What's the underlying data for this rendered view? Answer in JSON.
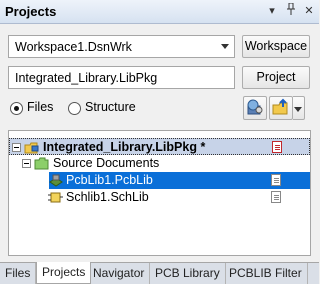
{
  "panel": {
    "title": "Projects",
    "title_buttons": [
      "▾",
      "📌",
      "✕"
    ]
  },
  "workspace": {
    "value": "Workspace1.DsnWrk",
    "button_label": "Workspace"
  },
  "project": {
    "value": "Integrated_Library.LibPkg",
    "button_label": "Project"
  },
  "view_mode": {
    "options": [
      "Files",
      "Structure"
    ],
    "selected": "Files"
  },
  "tree": {
    "project": "Integrated_Library.LibPkg *",
    "folder": "Source Documents",
    "documents": [
      {
        "label": "PcbLib1.PcbLib",
        "selected": true
      },
      {
        "label": "Schlib1.SchLib",
        "selected": false
      }
    ]
  },
  "tabs": [
    "Files",
    "Projects",
    "Navigator",
    "PCB Library",
    "PCBLIB Filter"
  ],
  "active_tab": "Projects",
  "icons": {
    "project_icon": "libpkg-project-icon",
    "folder_icon": "folder-icon",
    "pcblib_icon": "pcblib-icon",
    "schlib_icon": "schlib-icon",
    "compile_icon": "compile-icon",
    "options_icon": "project-options-icon"
  }
}
